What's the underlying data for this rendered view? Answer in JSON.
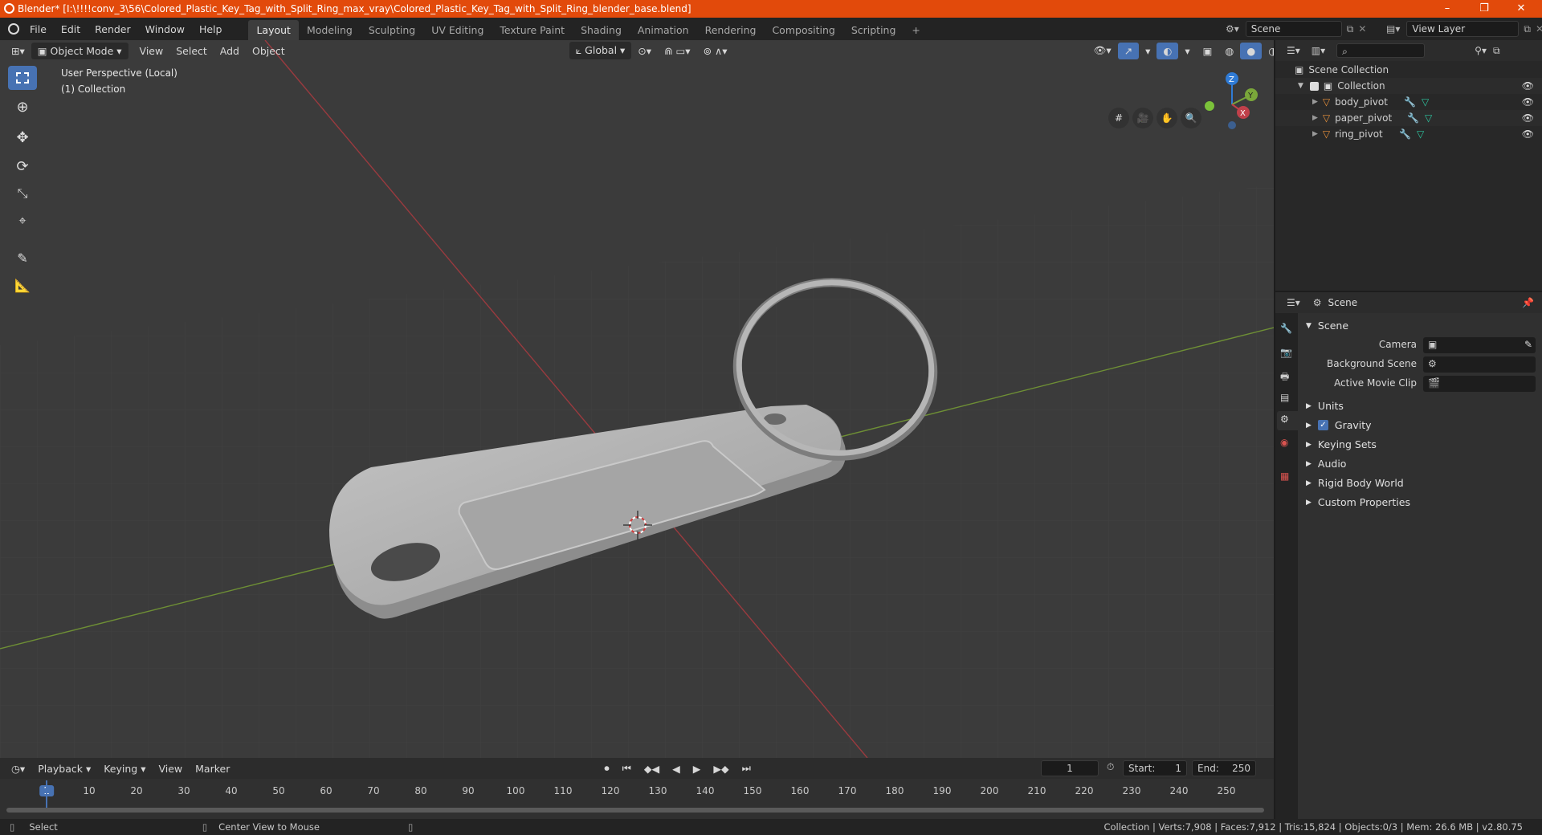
{
  "window": {
    "title": "Blender* [I:\\!!!!conv_3\\56\\Colored_Plastic_Key_Tag_with_Split_Ring_max_vray\\Colored_Plastic_Key_Tag_with_Split_Ring_blender_base.blend]",
    "controls": [
      "–",
      "❐",
      "✕"
    ]
  },
  "menu": [
    "File",
    "Edit",
    "Render",
    "Window",
    "Help"
  ],
  "workspaces": {
    "active": "Layout",
    "tabs": [
      "Layout",
      "Modeling",
      "Sculpting",
      "UV Editing",
      "Texture Paint",
      "Shading",
      "Animation",
      "Rendering",
      "Compositing",
      "Scripting"
    ],
    "add": "+"
  },
  "scene_selector": {
    "value": "Scene"
  },
  "view_layer_selector": {
    "value": "View Layer"
  },
  "viewport": {
    "mode": "Object Mode",
    "menus": [
      "View",
      "Select",
      "Add",
      "Object"
    ],
    "orientation": "Global",
    "overlay_title": "User Perspective (Local)",
    "overlay_collection": "(1) Collection",
    "gizmo_axes": [
      "X",
      "Y",
      "Z"
    ]
  },
  "outliner": {
    "root": "Scene Collection",
    "collection": "Collection",
    "objects": [
      "body_pivot",
      "paper_pivot",
      "ring_pivot"
    ]
  },
  "properties": {
    "header": "Scene",
    "panel": "Scene",
    "fields": [
      "Camera",
      "Background Scene",
      "Active Movie Clip"
    ],
    "sections": [
      "Units",
      "Gravity",
      "Keying Sets",
      "Audio",
      "Rigid Body World",
      "Custom Properties"
    ],
    "gravity_checked": true
  },
  "timeline": {
    "menus": [
      "Playback",
      "Keying",
      "View",
      "Marker"
    ],
    "current_frame": "1",
    "start_label": "Start:",
    "start": "1",
    "end_label": "End:",
    "end": "250",
    "ticks": [
      "1",
      "10",
      "20",
      "30",
      "40",
      "50",
      "60",
      "70",
      "80",
      "90",
      "100",
      "110",
      "120",
      "130",
      "140",
      "150",
      "160",
      "170",
      "180",
      "190",
      "200",
      "210",
      "220",
      "230",
      "240",
      "250"
    ]
  },
  "status": {
    "left": "Select",
    "middle": "Center View to Mouse",
    "right": "Collection | Verts:7,908 | Faces:7,912 | Tris:15,824 | Objects:0/3 | Mem: 26.6 MB | v2.80.75"
  },
  "colors": {
    "title_bar": "#e24a0b",
    "accent": "#4772b3",
    "x_axis": "#c0404a",
    "y_axis": "#7aa63a",
    "z_axis": "#2f7bd6"
  }
}
